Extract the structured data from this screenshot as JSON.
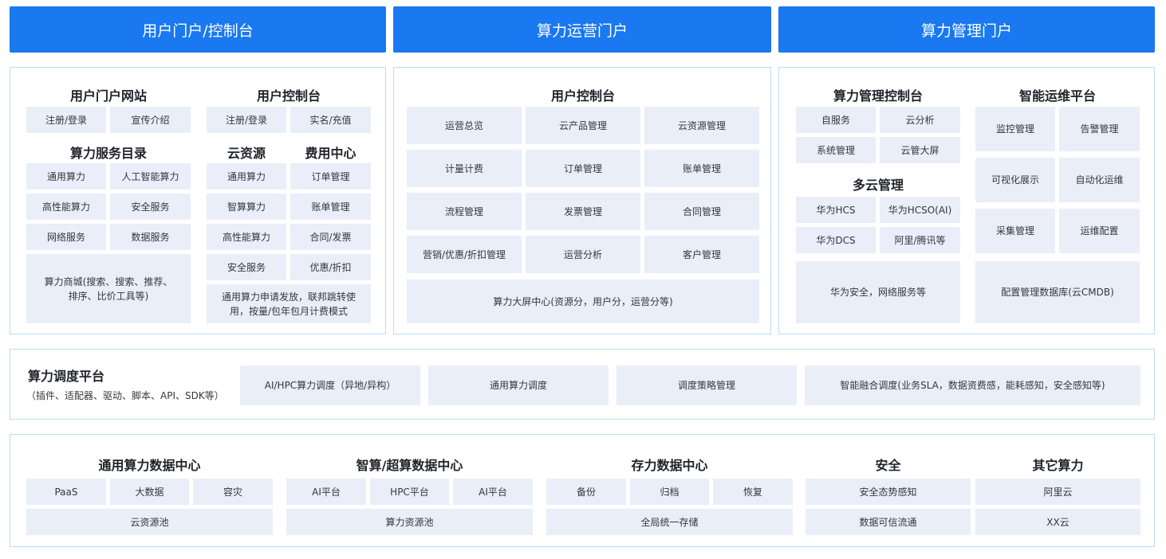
{
  "headers": {
    "user_portal": "用户门户/控制台",
    "ops_portal": "算力运营门户",
    "mgmt_portal": "算力管理门户"
  },
  "user_panel": {
    "portal_site": {
      "title": "用户门户网站",
      "items": [
        "注册/登录",
        "宣传介绍"
      ]
    },
    "console": {
      "title": "用户控制台",
      "items": [
        "注册/登录",
        "实名/充值"
      ]
    },
    "catalog": {
      "title": "算力服务目录",
      "items": [
        "通用算力",
        "人工智能算力",
        "高性能算力",
        "安全服务",
        "网络服务",
        "数据服务"
      ],
      "mall": "算力商城(搜索、搜索、推荐、排序、比价工具等)"
    },
    "cloud_resources": {
      "title": "云资源",
      "items": [
        "通用算力",
        "智算算力",
        "高性能算力",
        "安全服务"
      ]
    },
    "billing": {
      "title": "费用中心",
      "items": [
        "订单管理",
        "账单管理",
        "合同/发票",
        "优惠/折扣"
      ]
    },
    "general_apply": "通用算力申请发放，联邦跳转使用，按量/包年包月计费模式"
  },
  "ops_panel": {
    "title": "用户控制台",
    "items": [
      "运营总览",
      "云产品管理",
      "云资源管理",
      "计量计费",
      "订单管理",
      "账单管理",
      "流程管理",
      "发票管理",
      "合同管理",
      "营销/优惠/折扣管理",
      "运营分析",
      "客户管理"
    ],
    "dashboard": "算力大屏中心(资源分，用户分，运营分等)"
  },
  "mgmt_panel": {
    "console": {
      "title": "算力管理控制台",
      "items": [
        "自服务",
        "云分析",
        "系统管理",
        "云管大屏"
      ]
    },
    "multicloud": {
      "title": "多云管理",
      "items": [
        "华为HCS",
        "华为HCSO(AI)",
        "华为DCS",
        "阿里/腾讯等"
      ],
      "security": "华为安全，网络服务等"
    },
    "aiops": {
      "title": "智能运维平台",
      "items": [
        "监控管理",
        "告警管理",
        "可视化展示",
        "自动化运维",
        "采集管理",
        "运维配置"
      ],
      "cmdb": "配置管理数据库(云CMDB)"
    }
  },
  "scheduler": {
    "title": "算力调度平台",
    "subtitle": "（插件、适配器、驱动、脚本、API、SDK等）",
    "items": [
      "AI/HPC算力调度（异地/异构）",
      "通用算力调度",
      "调度策略管理",
      "智能融合调度(业务SLA，数据资费感，能耗感知，安全感知等)"
    ]
  },
  "datacenters": {
    "general": {
      "title": "通用算力数据中心",
      "items": [
        "PaaS",
        "大数据",
        "容灾"
      ],
      "pool": "云资源池"
    },
    "smart": {
      "title": "智算/超算数据中心",
      "items": [
        "AI平台",
        "HPC平台",
        "AI平台"
      ],
      "pool": "算力资源池"
    },
    "storage": {
      "title": "存力数据中心",
      "items": [
        "备份",
        "归档",
        "恢复"
      ],
      "pool": "全局统一存储"
    },
    "security": {
      "title": "安全",
      "items": [
        "安全态势感知",
        "数据可信流通"
      ]
    },
    "other": {
      "title": "其它算力",
      "items": [
        "阿里云",
        "XX云"
      ]
    }
  }
}
